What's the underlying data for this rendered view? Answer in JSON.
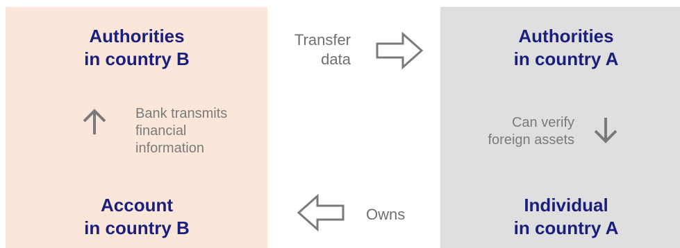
{
  "colors": {
    "panel_b": "#fbe7da",
    "panel_a": "#dfdfdf",
    "title": "#1a1f7c",
    "arrow": "#7a7a7a"
  },
  "boxes": {
    "authorities_b": {
      "line1": "Authorities",
      "line2": "in country B"
    },
    "authorities_a": {
      "line1": "Authorities",
      "line2": "in country A"
    },
    "account_b": {
      "line1": "Account",
      "line2": "in country B"
    },
    "individual_a": {
      "line1": "Individual",
      "line2": "in country A"
    }
  },
  "arrows": {
    "transfer": {
      "line1": "Transfer",
      "line2": "data",
      "icon": "outline-arrow-right-icon"
    },
    "bank": {
      "line1": "Bank transmits",
      "line2": "financial",
      "line3": "information",
      "icon": "arrow-up-icon"
    },
    "verify": {
      "line1": "Can verify",
      "line2": "foreign assets",
      "icon": "arrow-down-icon"
    },
    "owns": {
      "label": "Owns",
      "icon": "outline-arrow-left-icon"
    }
  }
}
